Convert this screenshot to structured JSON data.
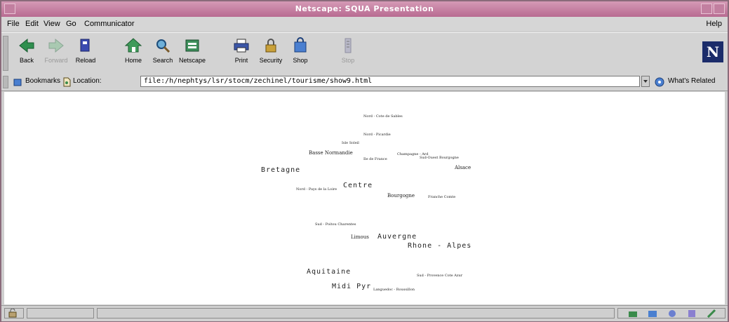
{
  "window": {
    "title": "Netscape: SQUA Presentation"
  },
  "menu": {
    "file": "File",
    "edit": "Edit",
    "view": "View",
    "go": "Go",
    "communicator": "Communicator",
    "help": "Help"
  },
  "toolbar": {
    "back": "Back",
    "forward": "Forward",
    "reload": "Reload",
    "home": "Home",
    "search": "Search",
    "netscape": "Netscape",
    "print": "Print",
    "security": "Security",
    "shop": "Shop",
    "stop": "Stop"
  },
  "location": {
    "bookmarks": "Bookmarks",
    "label": "Location:",
    "url": "file:/h/nephtys/lsr/stocm/zechinel/tourisme/show9.html",
    "whats_related": "What's Related"
  },
  "words": [
    {
      "text": "Nord - Cote de Sables",
      "size": "s"
    },
    {
      "text": "Nord - Picardie",
      "size": "s"
    },
    {
      "text": "Isle Soleil",
      "size": "s"
    },
    {
      "text": "Basse Normandie",
      "size": "m"
    },
    {
      "text": "Ile de France",
      "size": "s"
    },
    {
      "text": "Champagne - Ard",
      "size": "s"
    },
    {
      "text": "Sud-Ouest Bourgogne",
      "size": "s"
    },
    {
      "text": "Alsace",
      "size": "m"
    },
    {
      "text": "Bretagne",
      "size": "l"
    },
    {
      "text": "Centre",
      "size": "l"
    },
    {
      "text": "Nord - Pays de la Loire",
      "size": "s"
    },
    {
      "text": "Bourgogne",
      "size": "m"
    },
    {
      "text": "Franche Comte",
      "size": "s"
    },
    {
      "text": "Sud - Poitou Charentes",
      "size": "s"
    },
    {
      "text": "Limous",
      "size": "m"
    },
    {
      "text": "Auvergne",
      "size": "l"
    },
    {
      "text": "Rhone - Alpes",
      "size": "l"
    },
    {
      "text": "Aquitaine",
      "size": "l"
    },
    {
      "text": "Sud - Provence Cote Azur",
      "size": "s"
    },
    {
      "text": "Midi Pyr",
      "size": "l"
    },
    {
      "text": "Languedoc - Roussillon",
      "size": "s"
    }
  ],
  "colors": {
    "titlebar": "#b86a91",
    "chrome": "#d3d3d3"
  }
}
